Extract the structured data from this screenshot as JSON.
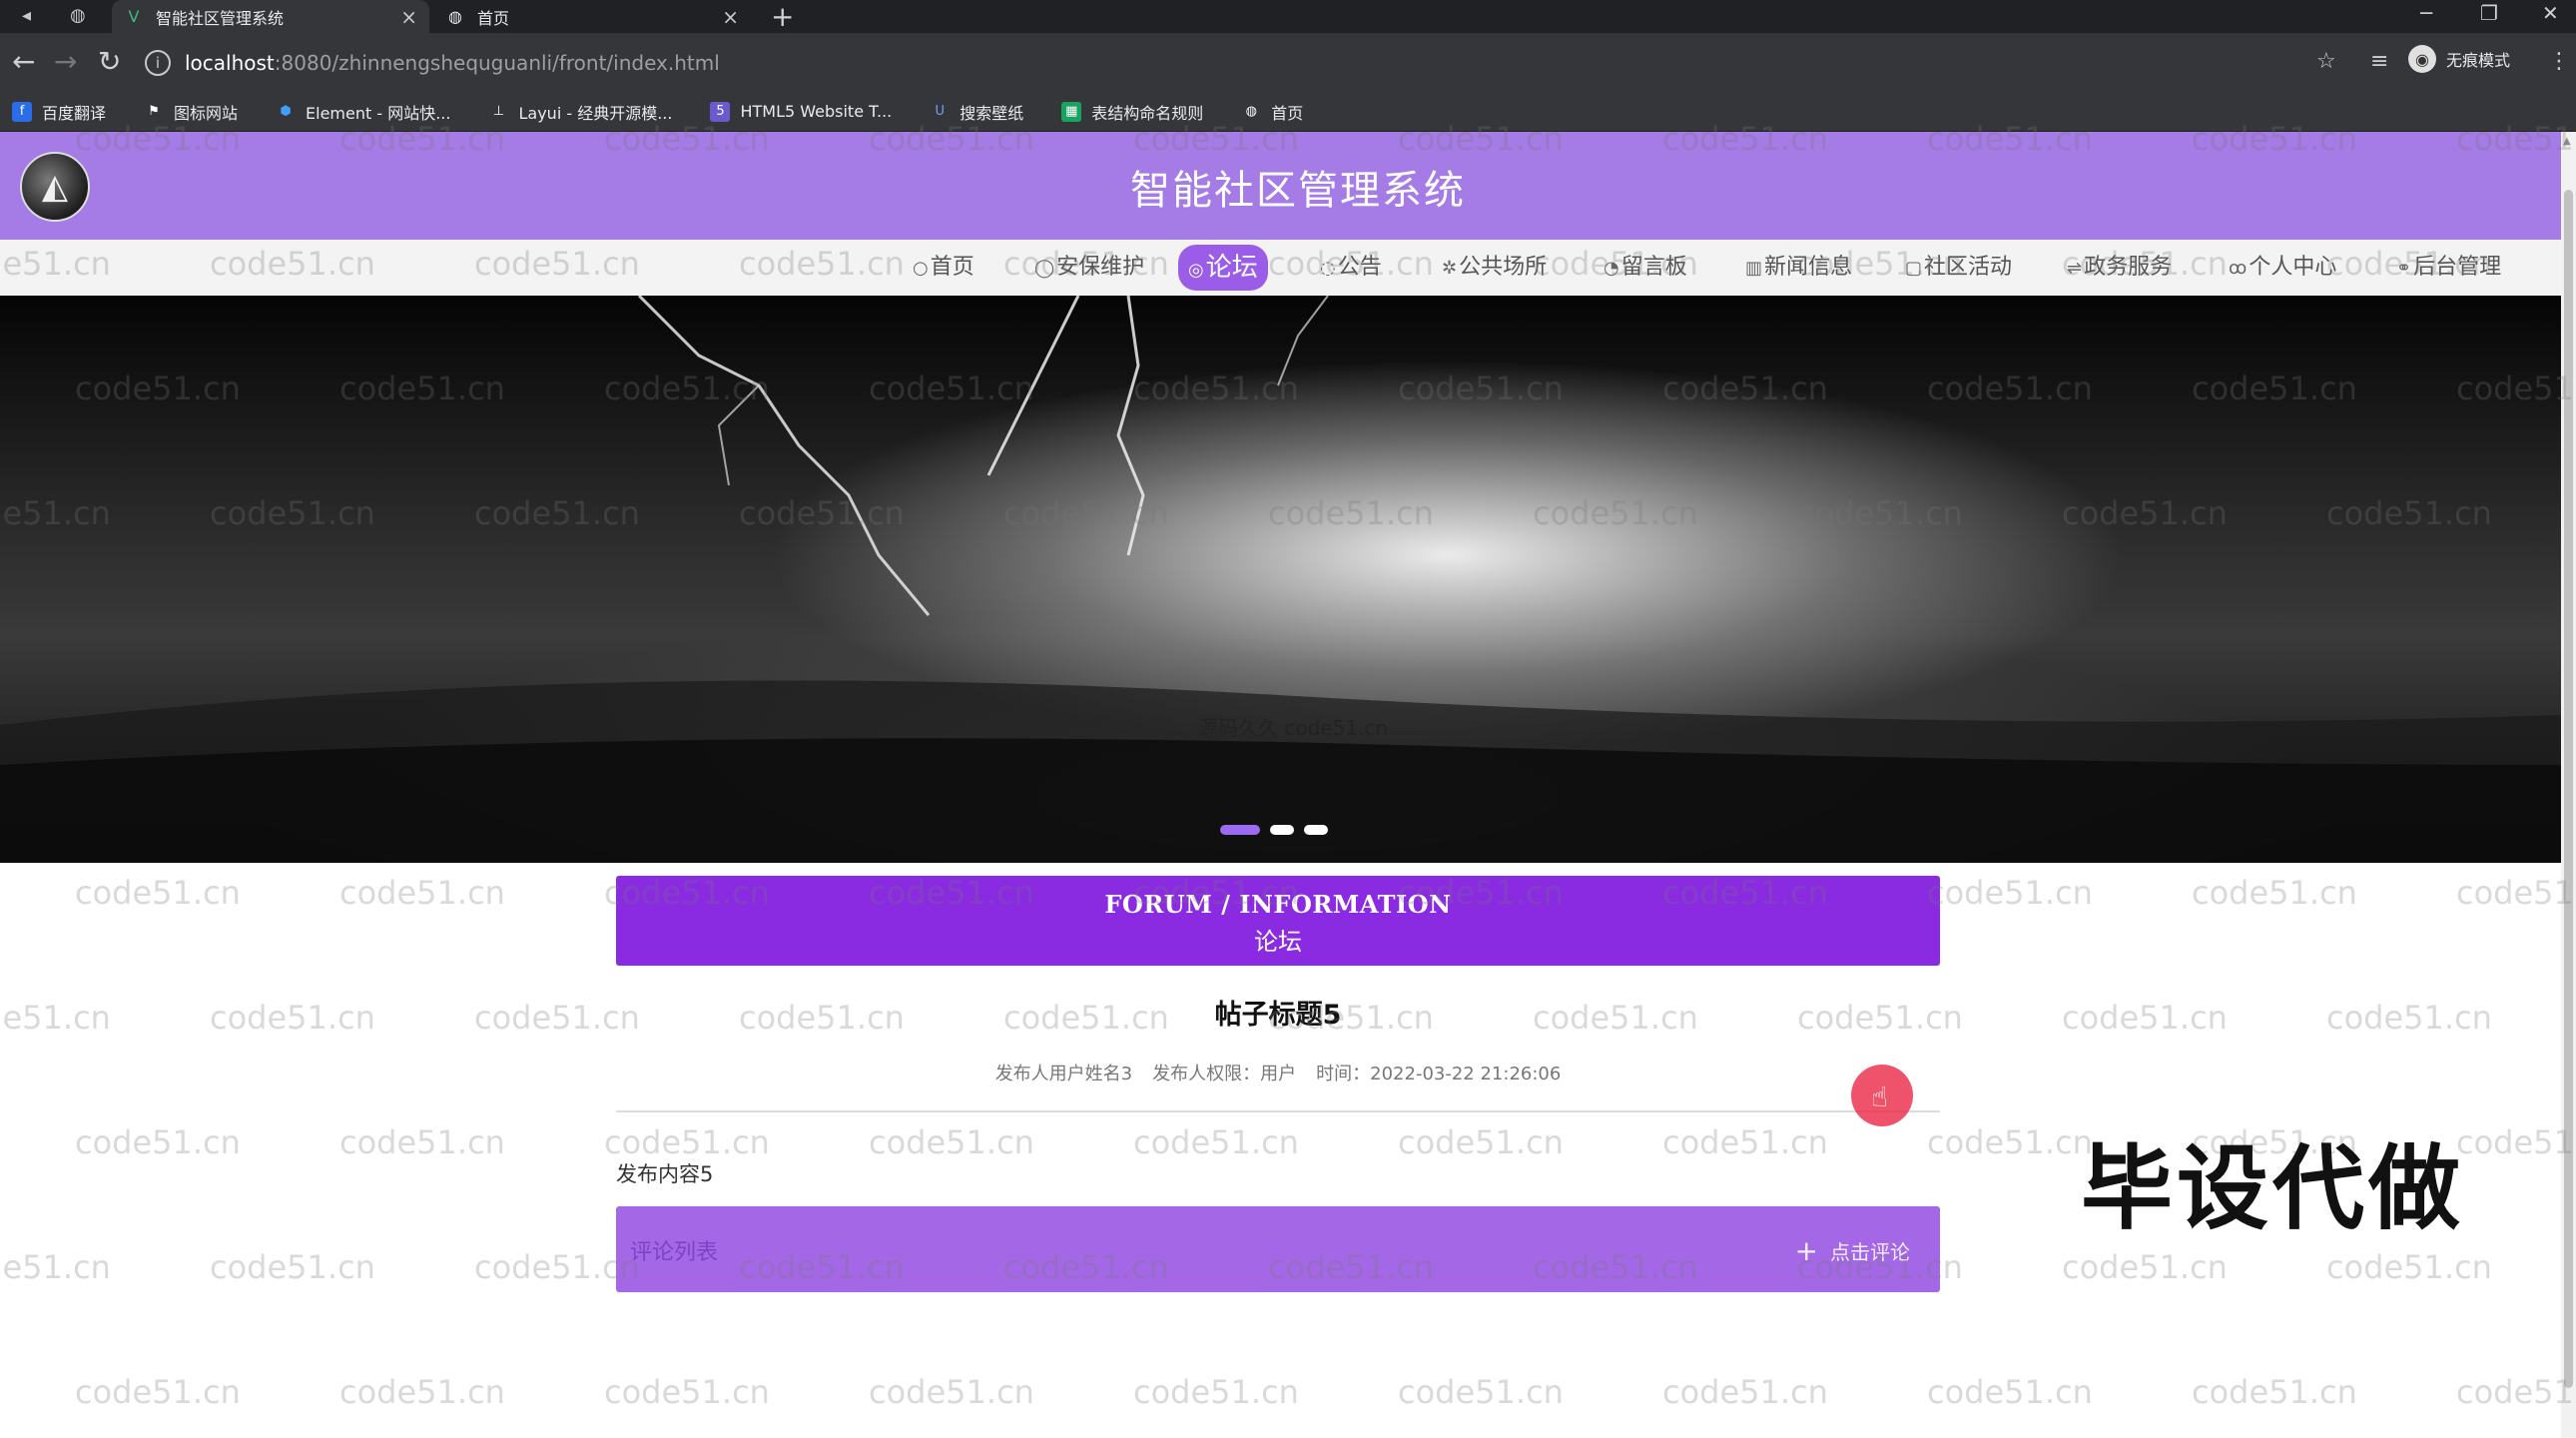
{
  "browser": {
    "tabs": [
      {
        "title": "智能社区管理系统",
        "favicon": "vue-logo-icon",
        "active": true
      },
      {
        "title": "首页",
        "favicon": "globe-icon",
        "active": false
      }
    ],
    "url_host": "localhost",
    "url_path": ":8080/zhinnengshequguanli/front/index.html",
    "profile_label": "无痕模式",
    "bookmarks": [
      {
        "label": "百度翻译",
        "icon": "translate-icon",
        "color": "#2b6de6"
      },
      {
        "label": "图标网站",
        "icon": "flag-icon",
        "color": "#666666"
      },
      {
        "label": "Element - 网站快...",
        "icon": "element-icon",
        "color": "#409eff"
      },
      {
        "label": "Layui - 经典开源模...",
        "icon": "layui-icon",
        "color": "#555555"
      },
      {
        "label": "HTML5 Website T...",
        "icon": "html5-icon",
        "color": "#6a5acd"
      },
      {
        "label": "搜索壁纸",
        "icon": "wallpaper-icon",
        "color": "#3a7bd5"
      },
      {
        "label": "表结构命名规则",
        "icon": "sheet-icon",
        "color": "#1aa260"
      },
      {
        "label": "首页",
        "icon": "globe-icon",
        "color": "#666666"
      }
    ]
  },
  "site": {
    "title": "智能社区管理系统",
    "header_color": "#a57be6",
    "accent_color": "#8a2be2"
  },
  "nav": {
    "items": [
      {
        "label": "首页",
        "icon": "home-icon",
        "active": false
      },
      {
        "label": "安保维护",
        "icon": "shield-icon",
        "active": false
      },
      {
        "label": "论坛",
        "icon": "forum-icon",
        "active": true
      },
      {
        "label": "公告",
        "icon": "notice-icon",
        "active": false
      },
      {
        "label": "公共场所",
        "icon": "place-icon",
        "active": false
      },
      {
        "label": "留言板",
        "icon": "message-icon",
        "active": false
      },
      {
        "label": "新闻信息",
        "icon": "news-icon",
        "active": false
      },
      {
        "label": "社区活动",
        "icon": "activity-icon",
        "active": false
      },
      {
        "label": "政务服务",
        "icon": "service-icon",
        "active": false
      },
      {
        "label": "个人中心",
        "icon": "user-icon",
        "active": false
      },
      {
        "label": "后台管理",
        "icon": "link-icon",
        "active": false
      }
    ]
  },
  "banner": {
    "caption": "源码久久 code51.cn",
    "slide_count": 3,
    "active_slide": 1
  },
  "section": {
    "title_en": "FORUM / INFORMATION",
    "title_zh": "论坛"
  },
  "post": {
    "title": "帖子标题5",
    "author": "发布人用户姓名3",
    "role": "发布人权限：用户",
    "time": "时间：2022-03-22 21:26:06",
    "content": "发布内容5"
  },
  "comments": {
    "label": "评论列表",
    "add_label": "点击评论"
  },
  "watermark": {
    "repeat_text": "code51.cn",
    "big_text": "毕设代做"
  }
}
